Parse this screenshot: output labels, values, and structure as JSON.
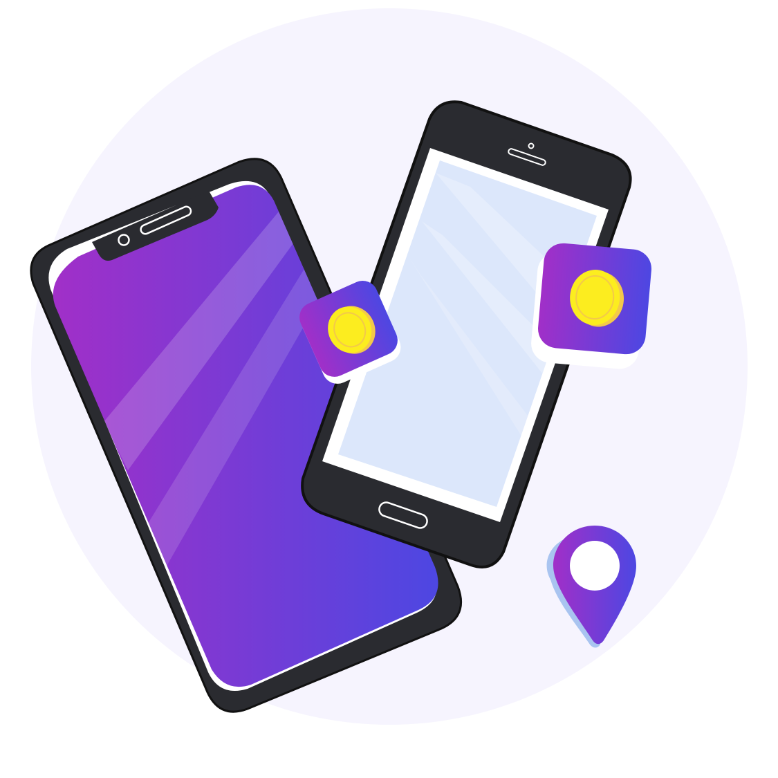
{
  "colors": {
    "background": "#ffffff",
    "backdrop_circle": "#f6f4fe",
    "phone_body": "#2a2b30",
    "phone_outline": "#111111",
    "screen_gradient_start": "#a12fc8",
    "screen_gradient_end": "#4d47e2",
    "light_screen": "#dce7fb",
    "coin": "#fced1f",
    "coin_edge": "#f3c94a",
    "pin_shadow": "#a9c4f0",
    "white": "#ffffff"
  },
  "icons": [
    "backdrop-circle",
    "phone-purple-screen-icon",
    "phone-light-screen-icon",
    "coin-app-icon-small",
    "coin-app-icon-large",
    "location-pin-icon"
  ]
}
